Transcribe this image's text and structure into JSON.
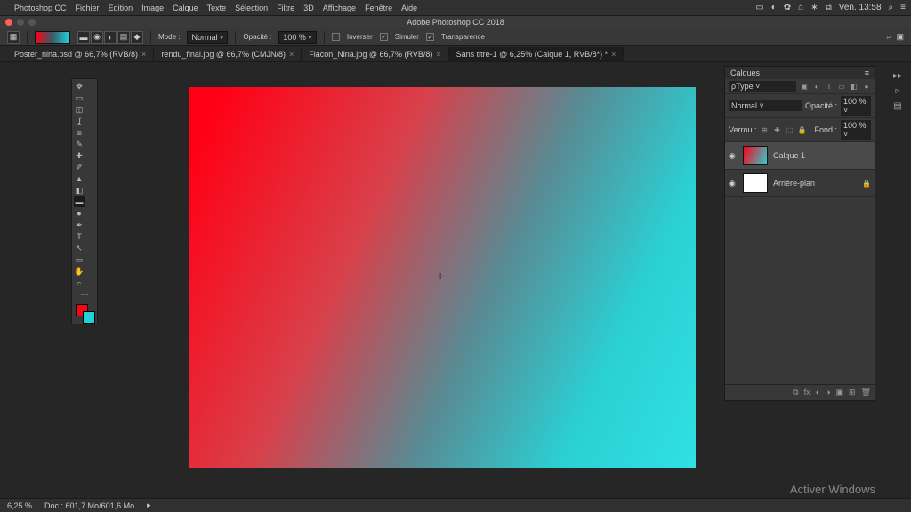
{
  "menubar": {
    "items": [
      "Photoshop CC",
      "Fichier",
      "Édition",
      "Image",
      "Calque",
      "Texte",
      "Sélection",
      "Filtre",
      "3D",
      "Affichage",
      "Fenêtre",
      "Aide"
    ],
    "right": {
      "time": "Ven. 13:58"
    }
  },
  "titlebar": {
    "title": "Adobe Photoshop CC 2018"
  },
  "optbar": {
    "mode_label": "Mode :",
    "mode_value": "Normal",
    "opacity_label": "Opacité :",
    "opacity_value": "100 %",
    "reverse": "Inverser",
    "simulate": "Simuler",
    "transparency": "Transparence"
  },
  "tabs": [
    {
      "label": "Poster_nina.psd @ 66,7% (RVB/8)",
      "active": false
    },
    {
      "label": "rendu_final.jpg @ 66,7% (CMJN/8)",
      "active": false
    },
    {
      "label": "Flacon_Nina.jpg @ 66,7% (RVB/8)",
      "active": false
    },
    {
      "label": "Sans titre-1 @ 6,25% (Calque 1, RVB/8*) *",
      "active": true
    }
  ],
  "colors": {
    "fg": "#ff0015",
    "bg": "#1fd4d8"
  },
  "layers": {
    "panel_title": "Calques",
    "type_label": "ρType",
    "blend": "Normal",
    "opacity_label": "Opacité :",
    "opacity": "100 %",
    "lock_label": "Verrou :",
    "fill_label": "Fond :",
    "fill": "100 %",
    "items": [
      {
        "name": "Calque 1",
        "thumb": "g",
        "locked": false,
        "active": true
      },
      {
        "name": "Arrière-plan",
        "thumb": "w",
        "locked": true,
        "active": false
      }
    ]
  },
  "status": {
    "zoom": "6,25 %",
    "doc": "Doc : 601,7 Mo/601,6 Mo"
  },
  "watermark": "Activer Windows"
}
